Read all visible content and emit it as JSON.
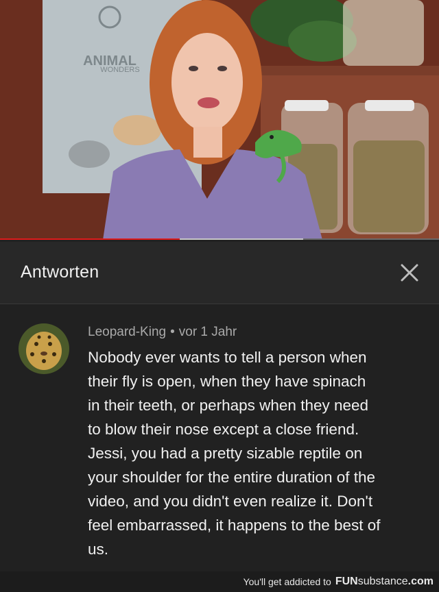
{
  "video": {
    "progress_played_fraction": 0.41,
    "progress_buffered_fraction": 0.69,
    "poster_logo_text": "ANIMAL WONDERS"
  },
  "panel": {
    "title": "Antworten"
  },
  "comment": {
    "author": "Leopard-King",
    "separator": "•",
    "time": "vor 1 Jahr",
    "text": "Nobody ever wants to tell a person when\ntheir fly is open, when they have spinach\nin their teeth, or perhaps when they need\nto blow their nose except a close friend.\nJessi, you had a  pretty sizable reptile on\nyour shoulder for the entire duration of the\nvideo, and you didn't even realize it.  Don't\nfeel embarrassed, it happens to the best of\nus."
  },
  "watermark": {
    "prefix": "You'll get addicted to",
    "brand_a": "FUN",
    "brand_b": "substance",
    "brand_c": ".com"
  },
  "colors": {
    "progress_played": "#e01b1b",
    "background": "#212121",
    "header": "#282828"
  }
}
